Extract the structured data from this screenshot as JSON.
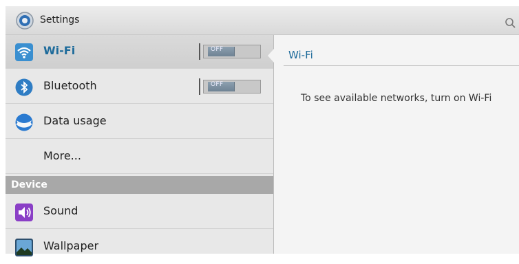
{
  "header": {
    "title": "Settings",
    "app_icon": "settings-gear-icon",
    "search_icon": "search-icon"
  },
  "left_list": {
    "items": [
      {
        "label": "Wi-Fi",
        "icon": "wifi-icon",
        "selected": true,
        "toggle": "OFF"
      },
      {
        "label": "Bluetooth",
        "icon": "bluetooth-icon",
        "selected": false,
        "toggle": "OFF"
      },
      {
        "label": "Data usage",
        "icon": "data-usage-icon",
        "selected": false
      },
      {
        "label": "More...",
        "selected": false
      }
    ],
    "section": "Device",
    "device_items": [
      {
        "label": "Sound",
        "icon": "sound-icon"
      },
      {
        "label": "Wallpaper",
        "icon": "wallpaper-icon"
      }
    ]
  },
  "detail": {
    "title": "Wi-Fi",
    "message": "To see available networks, turn on Wi-Fi"
  },
  "colors": {
    "accent": "#1e6b9b",
    "section_bg": "#a8a8a8",
    "list_bg": "#e8e8e8"
  }
}
